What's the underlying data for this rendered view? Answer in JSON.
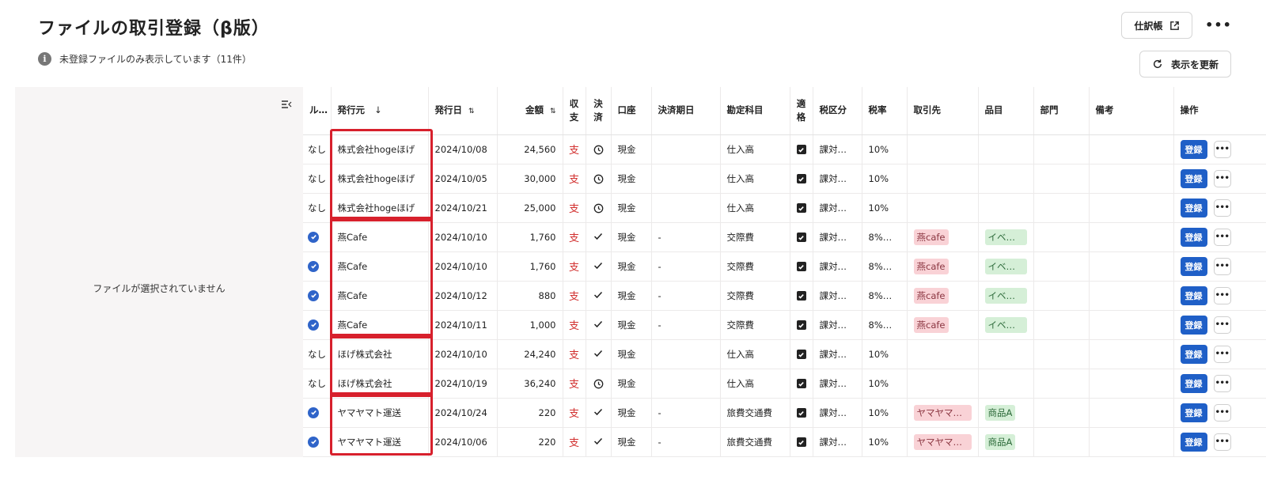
{
  "page": {
    "title": "ファイルの取引登録（β版）",
    "info_text": "未登録ファイルのみ表示しています（11件）"
  },
  "toolbar": {
    "journal_label": "仕訳帳",
    "refresh_label": "表示を更新",
    "more_label": "•••"
  },
  "file_panel": {
    "empty_text": "ファイルが選択されていません"
  },
  "table": {
    "headers": {
      "rule": "ル…",
      "issuer": "発行元",
      "issue_date": "発行日",
      "amount": "金額",
      "income_expense": [
        "収",
        "支"
      ],
      "settlement": [
        "決",
        "済"
      ],
      "account": "口座",
      "due_date": "決済期日",
      "category": "勘定科目",
      "qualified": [
        "適",
        "格"
      ],
      "tax_class": "税区分",
      "tax_rate": "税率",
      "partner": "取引先",
      "item": "品目",
      "department": "部門",
      "memo": "備考",
      "operation": "操作"
    },
    "register_label": "登録",
    "rows": [
      {
        "rule": "なし",
        "issuer": "株式会社hogeほげ",
        "date": "2024/10/08",
        "amount": "24,560",
        "kind": "支",
        "settled": false,
        "account": "現金",
        "due": "",
        "category": "仕入高",
        "tax_class": "課対仕…",
        "tax_rate": "10%",
        "partner": "",
        "item": ""
      },
      {
        "rule": "なし",
        "issuer": "株式会社hogeほげ",
        "date": "2024/10/05",
        "amount": "30,000",
        "kind": "支",
        "settled": false,
        "account": "現金",
        "due": "",
        "category": "仕入高",
        "tax_class": "課対仕…",
        "tax_rate": "10%",
        "partner": "",
        "item": ""
      },
      {
        "rule": "なし",
        "issuer": "株式会社hogeほげ",
        "date": "2024/10/21",
        "amount": "25,000",
        "kind": "支",
        "settled": false,
        "account": "現金",
        "due": "",
        "category": "仕入高",
        "tax_class": "課対仕…",
        "tax_rate": "10%",
        "partner": "",
        "item": ""
      },
      {
        "rule": "check",
        "issuer": "燕Cafe",
        "date": "2024/10/10",
        "amount": "1,760",
        "kind": "支",
        "settled": true,
        "account": "現金",
        "due": "-",
        "category": "交際費",
        "tax_class": "課対仕…",
        "tax_rate": "8%（…",
        "partner": "燕cafe",
        "item": "イベン…"
      },
      {
        "rule": "check",
        "issuer": "燕Cafe",
        "date": "2024/10/10",
        "amount": "1,760",
        "kind": "支",
        "settled": true,
        "account": "現金",
        "due": "-",
        "category": "交際費",
        "tax_class": "課対仕…",
        "tax_rate": "8%（…",
        "partner": "燕cafe",
        "item": "イベン…"
      },
      {
        "rule": "check",
        "issuer": "燕Cafe",
        "date": "2024/10/12",
        "amount": "880",
        "kind": "支",
        "settled": true,
        "account": "現金",
        "due": "-",
        "category": "交際費",
        "tax_class": "課対仕…",
        "tax_rate": "8%（…",
        "partner": "燕cafe",
        "item": "イベン…"
      },
      {
        "rule": "check",
        "issuer": "燕Cafe",
        "date": "2024/10/11",
        "amount": "1,000",
        "kind": "支",
        "settled": true,
        "account": "現金",
        "due": "-",
        "category": "交際費",
        "tax_class": "課対仕…",
        "tax_rate": "8%（…",
        "partner": "燕cafe",
        "item": "イベン…"
      },
      {
        "rule": "なし",
        "issuer": "ほげ株式会社",
        "date": "2024/10/10",
        "amount": "24,240",
        "kind": "支",
        "settled": true,
        "account": "現金",
        "due": "",
        "category": "仕入高",
        "tax_class": "課対仕…",
        "tax_rate": "10%",
        "partner": "",
        "item": ""
      },
      {
        "rule": "なし",
        "issuer": "ほげ株式会社",
        "date": "2024/10/19",
        "amount": "36,240",
        "kind": "支",
        "settled": false,
        "account": "現金",
        "due": "",
        "category": "仕入高",
        "tax_class": "課対仕…",
        "tax_rate": "10%",
        "partner": "",
        "item": ""
      },
      {
        "rule": "check",
        "issuer": "ヤマヤマト運送",
        "date": "2024/10/24",
        "amount": "220",
        "kind": "支",
        "settled": true,
        "account": "現金",
        "due": "-",
        "category": "旅費交通費",
        "tax_class": "課対仕…",
        "tax_rate": "10%",
        "partner": "ヤマヤマト…",
        "item": "商品A"
      },
      {
        "rule": "check",
        "issuer": "ヤマヤマト運送",
        "date": "2024/10/06",
        "amount": "220",
        "kind": "支",
        "settled": true,
        "account": "現金",
        "due": "-",
        "category": "旅費交通費",
        "tax_class": "課対仕…",
        "tax_rate": "10%",
        "partner": "ヤマヤマト…",
        "item": "商品A"
      }
    ]
  },
  "colors": {
    "accent_blue": "#1f5fc7",
    "expense_red": "#d2302f",
    "highlight_red": "#d7202c",
    "partner_tag": "#f9d2d6",
    "item_tag": "#d5efd7"
  },
  "highlight_groups": [
    {
      "issuer": "株式会社hogeほげ",
      "rows": 3
    },
    {
      "issuer": "燕Cafe",
      "rows": 4
    },
    {
      "issuer": "ほげ株式会社",
      "rows": 2
    },
    {
      "issuer": "ヤマヤマト運送",
      "rows": 2
    }
  ]
}
